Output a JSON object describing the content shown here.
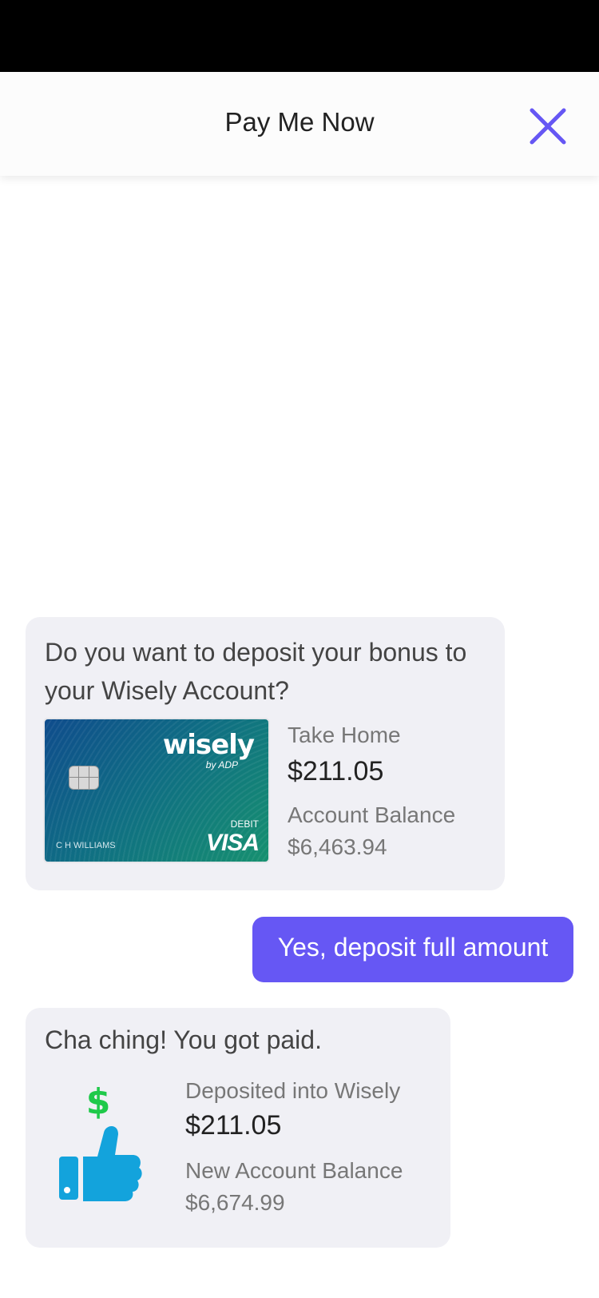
{
  "nav": {
    "title": "Pay Me Now",
    "close_icon": "close-icon",
    "accent": "#6657f4"
  },
  "messages": {
    "prompt": {
      "text": "Do you want to deposit your bonus to your Wisely Account?",
      "card": {
        "brand": "wisely",
        "sub_brand": "by ADP",
        "type": "DEBIT",
        "holder": "C H WILLIAMS",
        "network": "VISA"
      },
      "take_home_label": "Take Home",
      "take_home_value": "$211.05",
      "balance_label": "Account Balance",
      "balance_value": "$6,463.94"
    },
    "reply": {
      "text": "Yes, deposit full amount"
    },
    "confirmation": {
      "text": "Cha ching! You got paid.",
      "icon": "thumbs-up-dollar-icon",
      "deposited_label": "Deposited into Wisely",
      "deposited_value": "$211.05",
      "new_balance_label": "New Account Balance",
      "new_balance_value": "$6,674.99"
    }
  },
  "colors": {
    "bubble_in": "#f0f0f5",
    "bubble_out": "#6657f4",
    "dollar_green": "#1fc94a",
    "thumb_blue": "#13a3dc"
  }
}
